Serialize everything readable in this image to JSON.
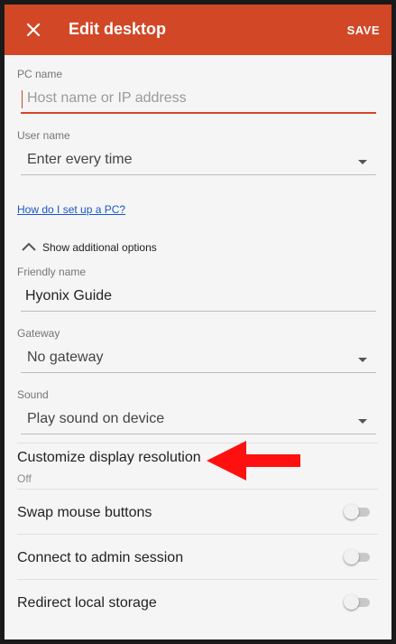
{
  "appbar": {
    "title": "Edit desktop",
    "save_label": "SAVE"
  },
  "pc_name": {
    "label": "PC name",
    "placeholder": "Host name or IP address",
    "value": ""
  },
  "user_name": {
    "label": "User name",
    "value": "Enter every time"
  },
  "help_link": "How do I set up a PC?",
  "additional_options": {
    "label": "Show additional options",
    "expanded": true
  },
  "friendly_name": {
    "label": "Friendly name",
    "value": "Hyonix Guide"
  },
  "gateway": {
    "label": "Gateway",
    "value": "No gateway"
  },
  "sound": {
    "label": "Sound",
    "value": "Play sound on device"
  },
  "display_resolution": {
    "title": "Customize display resolution",
    "value": "Off"
  },
  "toggles": [
    {
      "title": "Swap mouse buttons",
      "on": false
    },
    {
      "title": "Connect to admin session",
      "on": false
    },
    {
      "title": "Redirect local storage",
      "on": false
    }
  ],
  "colors": {
    "accent": "#d24726",
    "annotation_arrow": "#ff1010",
    "link": "#1a56c8"
  },
  "icons": {
    "close": "close-icon",
    "caret": "caret-down-icon",
    "expand": "chevron-up-icon"
  }
}
